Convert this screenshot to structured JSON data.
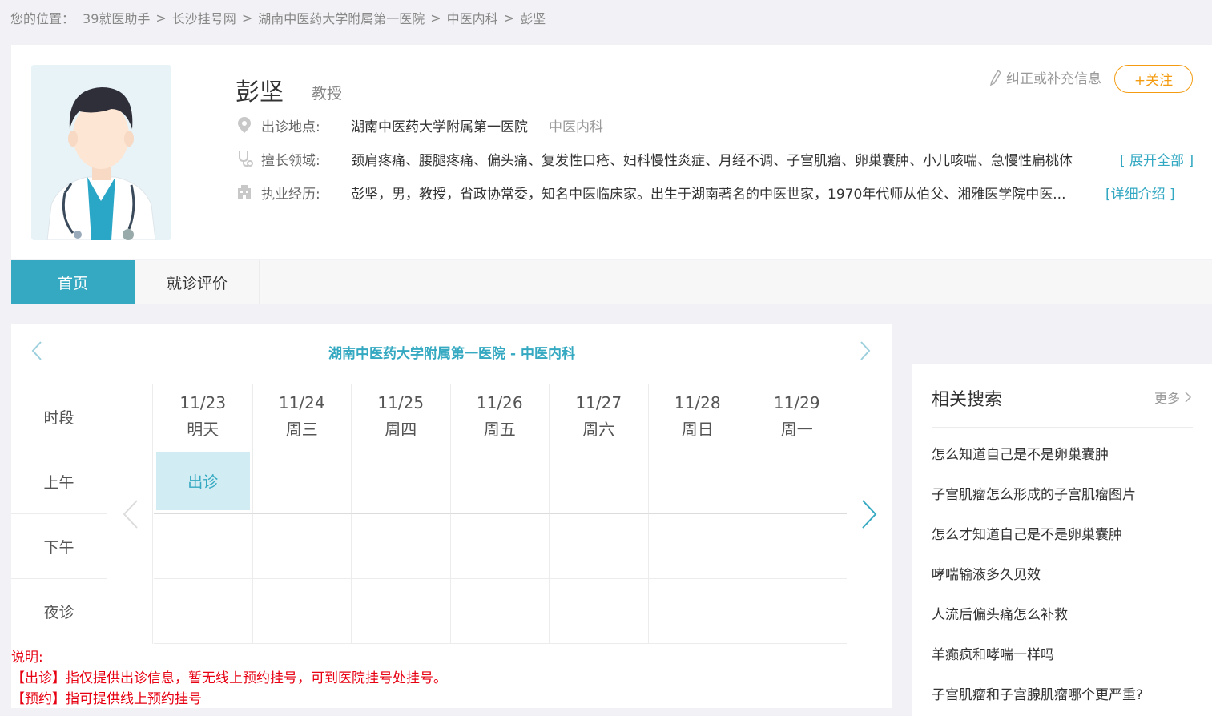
{
  "breadcrumb": {
    "prefix": "您的位置：",
    "items": [
      "39就医助手",
      "长沙挂号网",
      "湖南中医药大学附属第一医院",
      "中医内科",
      "彭坚"
    ],
    "separator": ">"
  },
  "doctor": {
    "name": "彭坚",
    "title": "教授",
    "location_label": "出诊地点:",
    "hospital": "湖南中医药大学附属第一医院",
    "department": "中医内科",
    "skill_label": "擅长领域:",
    "skills": "颈肩疼痛、腰腿疼痛、偏头痛、复发性口疮、妇科慢性炎症、月经不调、子宫肌瘤、卵巢囊肿、小儿咳喘、急慢性扁桃体",
    "skills_more": "[ 展开全部 ]",
    "experience_label": "执业经历:",
    "experience": "彭坚，男，教授，省政协常委，知名中医临床家。出生于湖南著名的中医世家，1970年代师从伯父、湘雅医学院中医...",
    "experience_more": "[详细介绍 ]",
    "correct_label": "纠正或补充信息",
    "follow_label": "+关注"
  },
  "tabs": [
    {
      "label": "首页",
      "active": true
    },
    {
      "label": "就诊评价",
      "active": false
    }
  ],
  "schedule": {
    "title": "湖南中医药大学附属第一医院 - 中医内科",
    "period_header": "时段",
    "periods": [
      "上午",
      "下午",
      "夜诊"
    ],
    "days": [
      {
        "date": "11/23",
        "weekday": "明天"
      },
      {
        "date": "11/24",
        "weekday": "周三"
      },
      {
        "date": "11/25",
        "weekday": "周四"
      },
      {
        "date": "11/26",
        "weekday": "周五"
      },
      {
        "date": "11/27",
        "weekday": "周六"
      },
      {
        "date": "11/28",
        "weekday": "周日"
      },
      {
        "date": "11/29",
        "weekday": "周一"
      }
    ],
    "slot_label": "出诊",
    "notes": {
      "title": "说明:",
      "line1": "【出诊】指仅提供出诊信息，暂无线上预约挂号，可到医院挂号处挂号。",
      "line2": "【预约】指可提供线上预约挂号"
    }
  },
  "related": {
    "title": "相关搜索",
    "more": "更多",
    "items": [
      "怎么知道自己是不是卵巢囊肿",
      "子宫肌瘤怎么形成的子宫肌瘤图片",
      "怎么才知道自己是不是卵巢囊肿",
      "哮喘输液多久见效",
      "人流后偏头痛怎么补救",
      "羊癫疯和哮喘一样吗",
      "子宫肌瘤和子宫腺肌瘤哪个更严重?"
    ]
  },
  "colors": {
    "accent": "#35a9c1",
    "follow": "#f39c12",
    "note_red": "#e60012"
  }
}
